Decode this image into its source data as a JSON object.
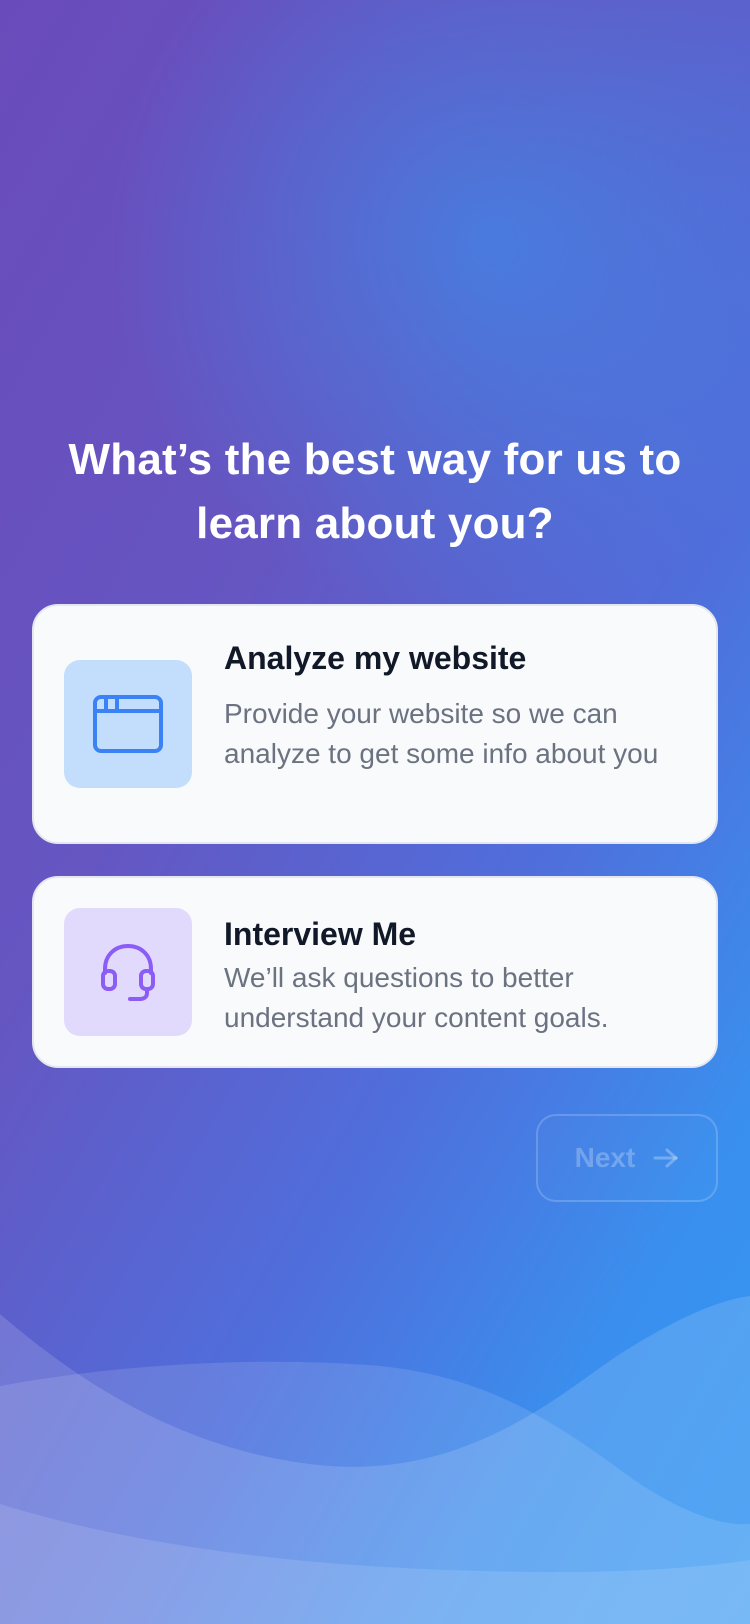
{
  "prompt": {
    "title": "What’s the best way for us to learn about you?"
  },
  "options": [
    {
      "title": "Analyze my website",
      "description": "Provide your website so we can analyze to get some info about you",
      "icon": "browser-window-icon",
      "icon_color": "#3b82f6",
      "tile_color": "#c3ddfd"
    },
    {
      "title": "Interview Me",
      "description": "We’ll ask questions to better understand your content goals.",
      "icon": "headset-icon",
      "icon_color": "#8b5cf6",
      "tile_color": "#e1dafd"
    }
  ],
  "next_button": {
    "label": "Next",
    "icon": "arrow-right-icon",
    "state": "disabled"
  },
  "colors": {
    "gradient_purple": "#6a4bbb",
    "gradient_blue": "#3498f3",
    "card_background": "#f8fafc",
    "title_text": "#111827",
    "body_text": "#6b7280"
  }
}
